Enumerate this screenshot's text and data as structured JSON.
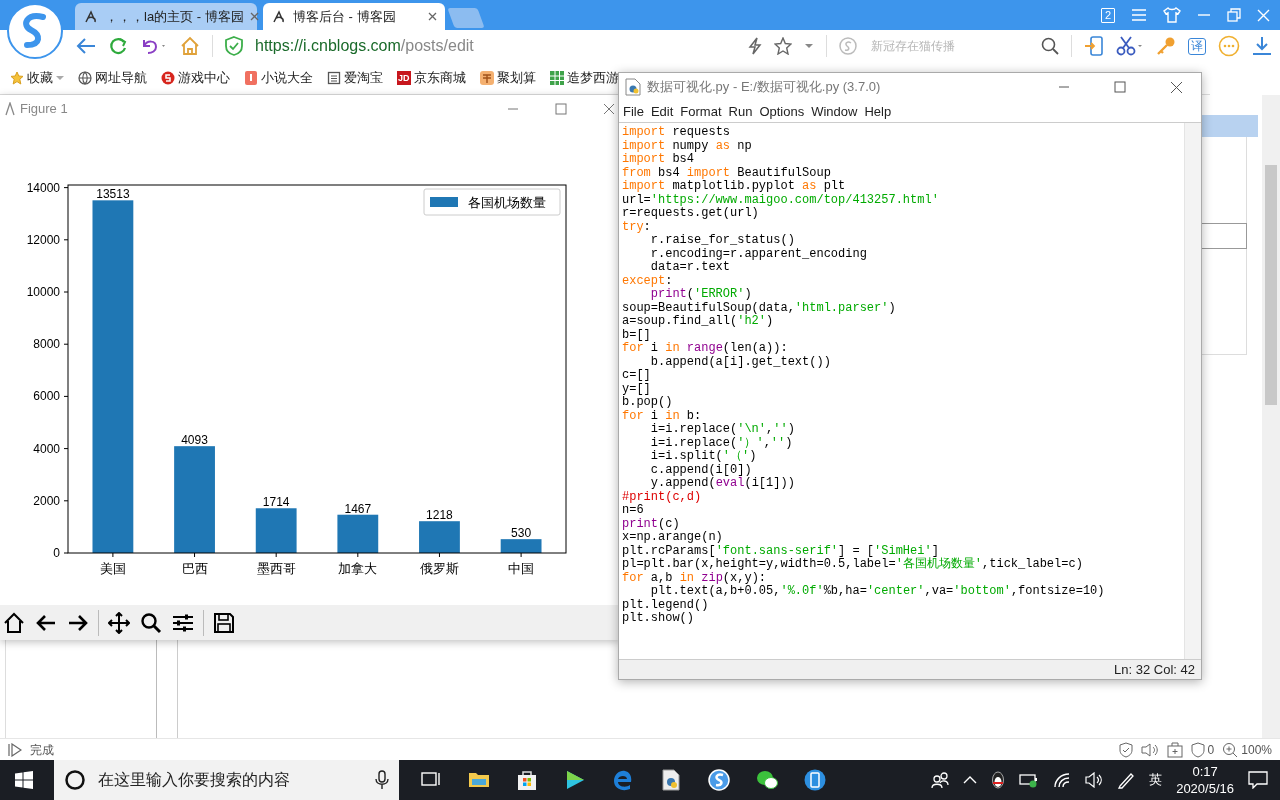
{
  "browser": {
    "tabs": [
      {
        "title": "，，，la的主页 - 博客园",
        "selected": false
      },
      {
        "title": "博客后台 - 博客园",
        "selected": true
      }
    ],
    "window_badge": "2",
    "address": {
      "host": "https://i.cnblogs.com",
      "path": "/posts/edit"
    },
    "search": {
      "placeholder": "新冠存在猫传播"
    },
    "translate_label": "译",
    "bookmarks": [
      {
        "label": "收藏",
        "kind": "star"
      },
      {
        "label": "网址导航",
        "kind": "globe"
      },
      {
        "label": "游戏中心",
        "kind": "game"
      },
      {
        "label": "小说大全",
        "kind": "novel"
      },
      {
        "label": "爱淘宝",
        "kind": "list"
      },
      {
        "label": "京东商城",
        "kind": "jd",
        "icon_text": "JD"
      },
      {
        "label": "聚划算",
        "kind": "deal"
      },
      {
        "label": "造梦西游",
        "kind": "grid"
      }
    ],
    "status": {
      "text": "完成",
      "ad_count": "0",
      "zoom": "100%"
    }
  },
  "figure": {
    "title": "Figure 1",
    "chart_data": {
      "type": "bar",
      "categories": [
        "美国",
        "巴西",
        "墨西哥",
        "加拿大",
        "俄罗斯",
        "中国"
      ],
      "series": [
        {
          "name": "各国机场数量",
          "color": "#1f77b4",
          "values": [
            13513,
            4093,
            1714,
            1467,
            1218,
            530
          ]
        }
      ],
      "ylim": [
        0,
        14100
      ],
      "yticks": [
        0,
        2000,
        4000,
        6000,
        8000,
        10000,
        12000,
        14000
      ],
      "data_labels": true
    }
  },
  "editor": {
    "title": "数据可视化.py - E:/数据可视化.py (3.7.0)",
    "menu": [
      "File",
      "Edit",
      "Format",
      "Run",
      "Options",
      "Window",
      "Help"
    ],
    "lines": [
      {
        "tokens": [
          {
            "kind": "keyword",
            "text": "import"
          },
          {
            "kind": "plain",
            "text": " requests"
          }
        ]
      },
      {
        "tokens": [
          {
            "kind": "keyword",
            "text": "import"
          },
          {
            "kind": "plain",
            "text": " numpy "
          },
          {
            "kind": "keyword",
            "text": "as"
          },
          {
            "kind": "plain",
            "text": " np"
          }
        ]
      },
      {
        "tokens": [
          {
            "kind": "keyword",
            "text": "import"
          },
          {
            "kind": "plain",
            "text": " bs4"
          }
        ]
      },
      {
        "tokens": [
          {
            "kind": "keyword",
            "text": "from"
          },
          {
            "kind": "plain",
            "text": " bs4 "
          },
          {
            "kind": "keyword",
            "text": "import"
          },
          {
            "kind": "plain",
            "text": " BeautifulSoup"
          }
        ]
      },
      {
        "tokens": [
          {
            "kind": "keyword",
            "text": "import"
          },
          {
            "kind": "plain",
            "text": " matplotlib.pyplot "
          },
          {
            "kind": "keyword",
            "text": "as"
          },
          {
            "kind": "plain",
            "text": " plt"
          }
        ]
      },
      {
        "tokens": [
          {
            "kind": "plain",
            "text": "url="
          },
          {
            "kind": "string",
            "text": "'https://www.maigoo.com/top/413257.html'"
          }
        ]
      },
      {
        "tokens": [
          {
            "kind": "plain",
            "text": "r=requests.get(url)"
          }
        ]
      },
      {
        "tokens": [
          {
            "kind": "keyword",
            "text": "try"
          },
          {
            "kind": "plain",
            "text": ":"
          }
        ]
      },
      {
        "tokens": [
          {
            "kind": "plain",
            "text": "    r.raise_for_status()"
          }
        ]
      },
      {
        "tokens": [
          {
            "kind": "plain",
            "text": "    r.encoding=r.apparent_encoding"
          }
        ]
      },
      {
        "tokens": [
          {
            "kind": "plain",
            "text": "    data=r.text"
          }
        ]
      },
      {
        "tokens": [
          {
            "kind": "keyword",
            "text": "except"
          },
          {
            "kind": "plain",
            "text": ":"
          }
        ]
      },
      {
        "indent": true,
        "tokens": [
          {
            "kind": "builtin",
            "text": "print"
          },
          {
            "kind": "plain",
            "text": "("
          },
          {
            "kind": "string",
            "text": "'ERROR'"
          },
          {
            "kind": "plain",
            "text": ")"
          }
        ]
      },
      {
        "tokens": [
          {
            "kind": "plain",
            "text": "soup=BeautifulSoup(data,"
          },
          {
            "kind": "string",
            "text": "'html.parser'"
          },
          {
            "kind": "plain",
            "text": ")"
          }
        ]
      },
      {
        "tokens": [
          {
            "kind": "plain",
            "text": "a=soup.find_all("
          },
          {
            "kind": "string",
            "text": "'h2'"
          },
          {
            "kind": "plain",
            "text": ")"
          }
        ]
      },
      {
        "tokens": [
          {
            "kind": "plain",
            "text": "b=[]"
          }
        ]
      },
      {
        "tokens": [
          {
            "kind": "keyword",
            "text": "for"
          },
          {
            "kind": "plain",
            "text": " i "
          },
          {
            "kind": "keyword",
            "text": "in"
          },
          {
            "kind": "builtin",
            "text": " range"
          },
          {
            "kind": "plain",
            "text": "(len(a)):"
          }
        ]
      },
      {
        "tokens": [
          {
            "kind": "plain",
            "text": "    b.append(a[i].get_text())"
          }
        ]
      },
      {
        "tokens": [
          {
            "kind": "plain",
            "text": "c=[]"
          }
        ]
      },
      {
        "tokens": [
          {
            "kind": "plain",
            "text": "y=[]"
          }
        ]
      },
      {
        "tokens": [
          {
            "kind": "plain",
            "text": "b.pop()"
          }
        ]
      },
      {
        "tokens": [
          {
            "kind": "keyword",
            "text": "for"
          },
          {
            "kind": "plain",
            "text": " i "
          },
          {
            "kind": "keyword",
            "text": "in"
          },
          {
            "kind": "plain",
            "text": " b:"
          }
        ]
      },
      {
        "tokens": [
          {
            "kind": "plain",
            "text": "    i=i.replace("
          },
          {
            "kind": "string",
            "text": "'\\n'"
          },
          {
            "kind": "plain",
            "text": ","
          },
          {
            "kind": "string",
            "text": "''"
          },
          {
            "kind": "plain",
            "text": ")"
          }
        ]
      },
      {
        "tokens": [
          {
            "kind": "plain",
            "text": "    i=i.replace("
          },
          {
            "kind": "string",
            "text": "'）'"
          },
          {
            "kind": "plain",
            "text": ","
          },
          {
            "kind": "string",
            "text": "''"
          },
          {
            "kind": "plain",
            "text": ")"
          }
        ]
      },
      {
        "tokens": [
          {
            "kind": "plain",
            "text": "    i=i.split("
          },
          {
            "kind": "string",
            "text": "'（'"
          },
          {
            "kind": "plain",
            "text": ")"
          }
        ]
      },
      {
        "tokens": [
          {
            "kind": "plain",
            "text": "    c.append(i[0])"
          }
        ]
      },
      {
        "tokens": [
          {
            "kind": "plain",
            "text": "    y.append("
          },
          {
            "kind": "builtin",
            "text": "eval"
          },
          {
            "kind": "plain",
            "text": "(i[1]))"
          }
        ]
      },
      {
        "tokens": [
          {
            "kind": "comment",
            "text": "#print(c,d)"
          }
        ]
      },
      {
        "tokens": [
          {
            "kind": "plain",
            "text": "n=6"
          }
        ]
      },
      {
        "tokens": [
          {
            "kind": "builtin",
            "text": "print"
          },
          {
            "kind": "plain",
            "text": "(c)"
          }
        ]
      },
      {
        "tokens": [
          {
            "kind": "plain",
            "text": "x=np.arange(n)"
          }
        ]
      },
      {
        "tokens": [
          {
            "kind": "plain",
            "text": "plt.rcParams["
          },
          {
            "kind": "string",
            "text": "'font.sans-serif'"
          },
          {
            "kind": "plain",
            "text": "] = ["
          },
          {
            "kind": "string",
            "text": "'SimHei'"
          },
          {
            "kind": "plain",
            "text": "]"
          }
        ]
      },
      {
        "tokens": [
          {
            "kind": "plain",
            "text": "pl=plt.bar(x,height=y,width=0.5,label="
          },
          {
            "kind": "string",
            "text": "'各国机场数量'"
          },
          {
            "kind": "plain",
            "text": ",tick_label=c)"
          }
        ]
      },
      {
        "tokens": [
          {
            "kind": "keyword",
            "text": "for"
          },
          {
            "kind": "plain",
            "text": " a,b "
          },
          {
            "kind": "keyword",
            "text": "in"
          },
          {
            "kind": "builtin",
            "text": " zip"
          },
          {
            "kind": "plain",
            "text": "(x,y):"
          }
        ]
      },
      {
        "tokens": [
          {
            "kind": "plain",
            "text": "    plt.text(a,b+0.05,"
          },
          {
            "kind": "string",
            "text": "'%.0f'"
          },
          {
            "kind": "plain",
            "text": "%b,ha="
          },
          {
            "kind": "string",
            "text": "'center'"
          },
          {
            "kind": "plain",
            "text": ",va="
          },
          {
            "kind": "string",
            "text": "'bottom'"
          },
          {
            "kind": "plain",
            "text": ",fontsize=10)"
          }
        ]
      },
      {
        "tokens": [
          {
            "kind": "plain",
            "text": "plt.legend()"
          }
        ]
      },
      {
        "tokens": [
          {
            "kind": "plain",
            "text": "plt.show()"
          }
        ]
      }
    ],
    "status": "Ln: 32 Col: 42"
  },
  "taskbar": {
    "search": {
      "placeholder": "在这里输入你要搜索的内容"
    },
    "input_method": "英",
    "time": "0:17",
    "date": "2020/5/16"
  }
}
